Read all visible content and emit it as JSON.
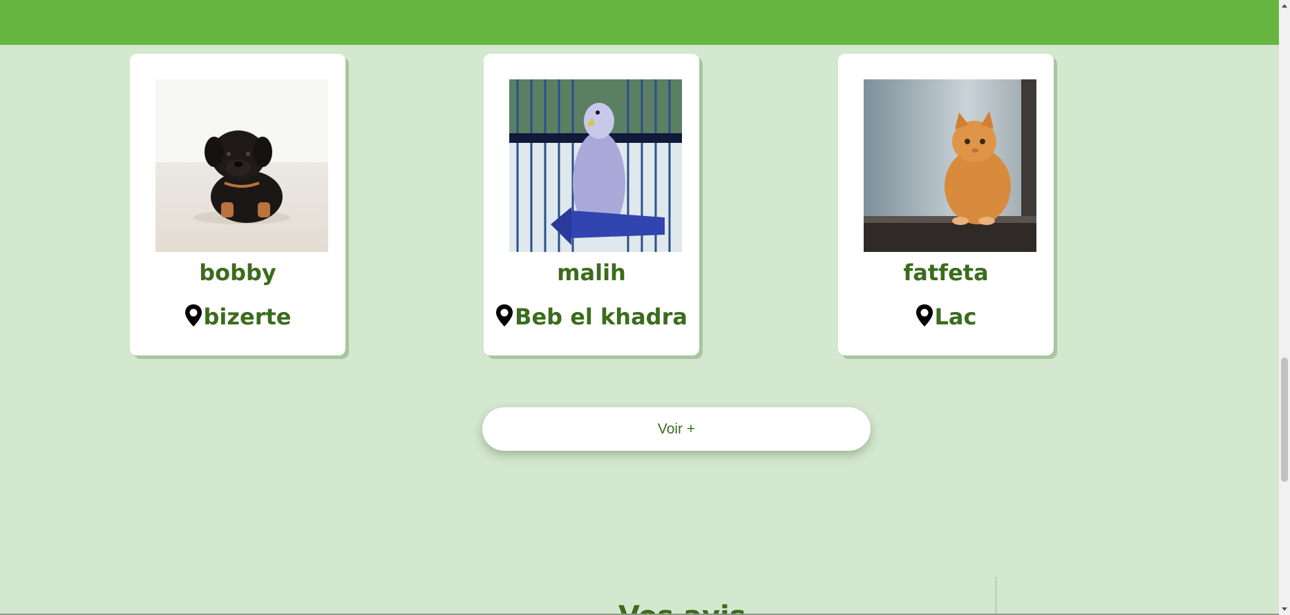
{
  "pets": [
    {
      "name": "bobby",
      "location": "bizerte",
      "photo_icon": "puppy-photo"
    },
    {
      "name": "malih",
      "location": "Beb el khadra",
      "photo_icon": "parakeet-photo"
    },
    {
      "name": "fatfeta",
      "location": "Lac",
      "photo_icon": "cat-photo"
    }
  ],
  "voir_plus_label": "Voir +",
  "reviews": {
    "title": "Vos avis"
  },
  "colors": {
    "header_green": "#67b640",
    "page_background": "#d4e7cf",
    "text_green": "#3b6c1d"
  }
}
